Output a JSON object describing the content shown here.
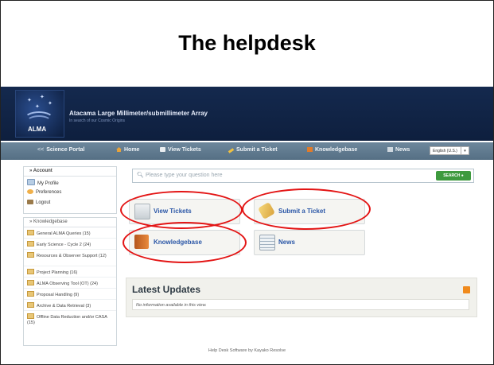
{
  "slide": {
    "title": "The helpdesk"
  },
  "site": {
    "logo_text": "ALMA",
    "name": "Atacama Large Millimeter/submillimeter Array",
    "tagline": "In search of our Cosmic Origins"
  },
  "nav": {
    "items": [
      {
        "label": "Science Portal",
        "prefix": "<<"
      },
      {
        "label": "Home"
      },
      {
        "label": "View Tickets"
      },
      {
        "label": "Submit a Ticket"
      },
      {
        "label": "Knowledgebase"
      },
      {
        "label": "News"
      }
    ],
    "language": "English (U.S.)"
  },
  "sidebar": {
    "account_title": "Account",
    "account_items": [
      "My Profile",
      "Preferences",
      "Logout"
    ],
    "kb_title": "Knowledgebase",
    "kb_items": [
      "General ALMA Queries (15)",
      "Early Science - Cycle 2 (24)",
      "Resources & Observer Support (12)",
      "Project Planning (16)",
      "ALMA Observing Tool (OT) (24)",
      "Proposal Handling (9)",
      "Archive & Data Retrieval (3)",
      "Offline Data Reduction and/or CASA (15)"
    ]
  },
  "search": {
    "placeholder": "Please type your question here",
    "button": "SEARCH"
  },
  "tiles": {
    "view_tickets": "View Tickets",
    "submit_ticket": "Submit a Ticket",
    "knowledgebase": "Knowledgebase",
    "news": "News"
  },
  "latest": {
    "title": "Latest Updates",
    "empty_text": "No information available in this view."
  },
  "footer": "Help Desk Software by Kayako Resolve",
  "colors": {
    "highlight_ring": "#e31414",
    "header_bg": "#14294e",
    "nav_bg": "#60798e",
    "link": "#2b57a7"
  }
}
